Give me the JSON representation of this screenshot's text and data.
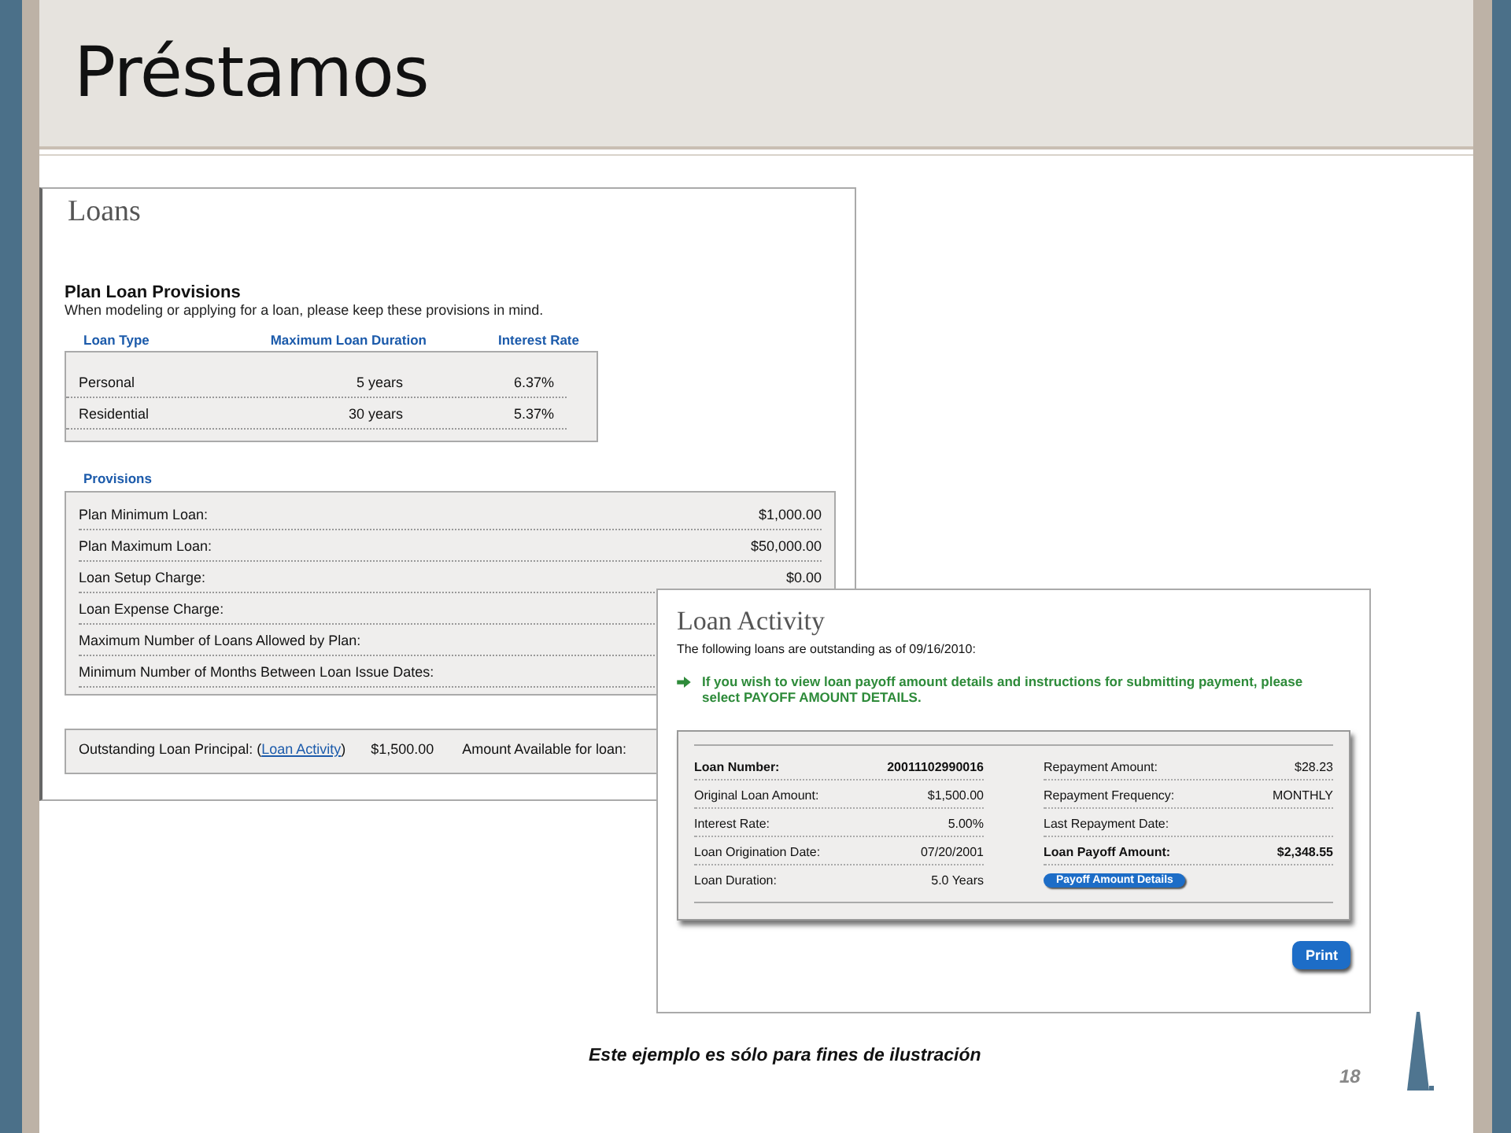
{
  "slide": {
    "title": "Préstamos",
    "caption": "Este ejemplo es sólo para fines de ilustración",
    "page_number": "18"
  },
  "loans": {
    "title": "Loans",
    "section_title": "Plan Loan Provisions",
    "section_text": "When modeling or applying for a loan, please keep these provisions in mind.",
    "loan_types": {
      "columns": [
        "Loan Type",
        "Maximum Loan Duration",
        "Interest Rate"
      ],
      "rows": [
        [
          "Personal",
          "5 years",
          "6.37%"
        ],
        [
          "Residential",
          "30 years",
          "5.37%"
        ]
      ]
    },
    "provisions": {
      "title": "Provisions",
      "rows": [
        {
          "label": "Plan Minimum Loan:",
          "value": "$1,000.00"
        },
        {
          "label": "Plan Maximum Loan:",
          "value": "$50,000.00"
        },
        {
          "label": "Loan Setup Charge:",
          "value": "$0.00"
        },
        {
          "label": "Loan Expense Charge:"
        },
        {
          "label": "Maximum Number of Loans Allowed by Plan:"
        },
        {
          "label": "Minimum Number of Months Between Loan Issue Dates:"
        }
      ]
    },
    "outstanding": {
      "label_before": "Outstanding Loan Principal: (",
      "link": "Loan Activity",
      "label_after": ")",
      "value": "$1,500.00",
      "available_label": "Amount Available for loan:"
    }
  },
  "activity": {
    "title": "Loan Activity",
    "intro": "The following loans are outstanding as of 09/16/2010:",
    "notice": "If you wish to view loan payoff amount details and instructions for submitting payment, please select PAYOFF AMOUNT DETAILS.",
    "rows": [
      {
        "left": {
          "label": "Loan Number:",
          "value": "20011102990016",
          "emphasized": true
        },
        "right": {
          "kind": "field",
          "label": "Repayment Amount:",
          "value": "$28.23",
          "emphasized": false
        }
      },
      {
        "left": {
          "label": "Original Loan Amount:",
          "value": "$1,500.00",
          "emphasized": false
        },
        "right": {
          "kind": "field",
          "label": "Repayment Frequency:",
          "value": "MONTHLY",
          "emphasized": false
        }
      },
      {
        "left": {
          "label": "Interest Rate:",
          "value": "5.00%",
          "emphasized": false
        },
        "right": {
          "kind": "field",
          "label": "Last Repayment Date:",
          "emphasized": false
        }
      },
      {
        "left": {
          "label": "Loan Origination Date:",
          "value": "07/20/2001",
          "emphasized": false
        },
        "right": {
          "kind": "field",
          "label": "Loan Payoff Amount:",
          "value": "$2,348.55",
          "emphasized": true
        }
      },
      {
        "left": {
          "label": "Loan Duration:",
          "value": "5.0 Years",
          "emphasized": false
        },
        "right": {
          "kind": "button",
          "label": "Payoff Amount Details"
        }
      }
    ],
    "print_button": "Print"
  }
}
